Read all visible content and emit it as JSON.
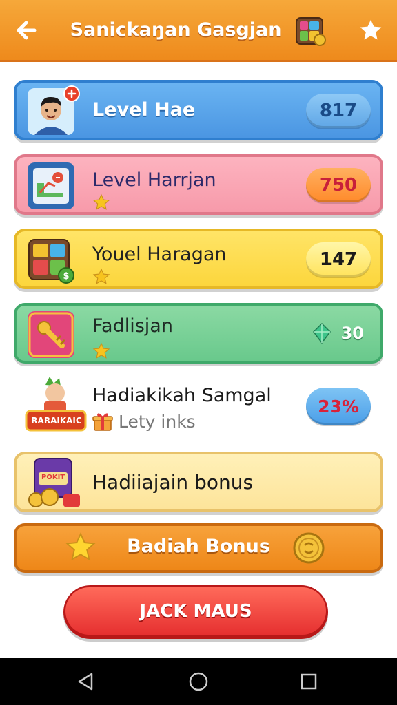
{
  "header": {
    "title": "Sanickaŋan Gasgjan",
    "back_icon": "back-arrow-icon",
    "favorite_icon": "star-icon",
    "game_icon": "puzzle-box-icon",
    "color": "#ee8a1c"
  },
  "rows": [
    {
      "label": "Level Hae",
      "value": "817",
      "thumb_icon": "avatar-boy-icon",
      "color": "#4b96e2"
    },
    {
      "label": "Level Harrjan",
      "value": "750",
      "thumb_icon": "chart-card-icon",
      "color": "#f79aaa"
    },
    {
      "label": "Youel Haragan",
      "value": "147",
      "thumb_icon": "puzzle-board-icon",
      "color": "#fcd63c"
    },
    {
      "label": "Fadlisjan",
      "value": "30",
      "thumb_icon": "golden-key-icon",
      "value_icon": "gem-icon",
      "color": "#69c98c"
    }
  ],
  "special_row": {
    "label": "Hadiakikah Samgal",
    "sub_label": "Lety inks",
    "value": "23%",
    "badge_text": "RARAIKAIC",
    "thumb_icon": "character-badge-icon",
    "sub_icon": "gift-box-icon"
  },
  "bonus_row": {
    "label": "Hadiiajain bonus",
    "badge_text": "POKIT",
    "thumb_icon": "slot-machine-icon"
  },
  "badiah_button": {
    "label": "Badiah Bonus",
    "left_icon": "star-icon",
    "right_icon": "gold-coin-icon"
  },
  "primary_button": {
    "label": "JACK MAUS",
    "color": "#e63030"
  },
  "navbar": {
    "back": "nav-back-icon",
    "home": "nav-home-icon",
    "recents": "nav-recents-icon"
  }
}
